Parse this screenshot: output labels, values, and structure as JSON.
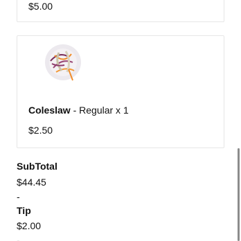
{
  "previous_item": {
    "price": "$5.00"
  },
  "item": {
    "image_icon": "coleslaw-salad-image",
    "name": "Coleslaw",
    "detail": " - Regular x 1",
    "price": "$2.50"
  },
  "summary": {
    "subtotal_label": "SubTotal",
    "subtotal_value": "$44.45",
    "separator_1": "-",
    "tip_label": "Tip",
    "tip_value": "$2.00",
    "separator_2": "-"
  }
}
